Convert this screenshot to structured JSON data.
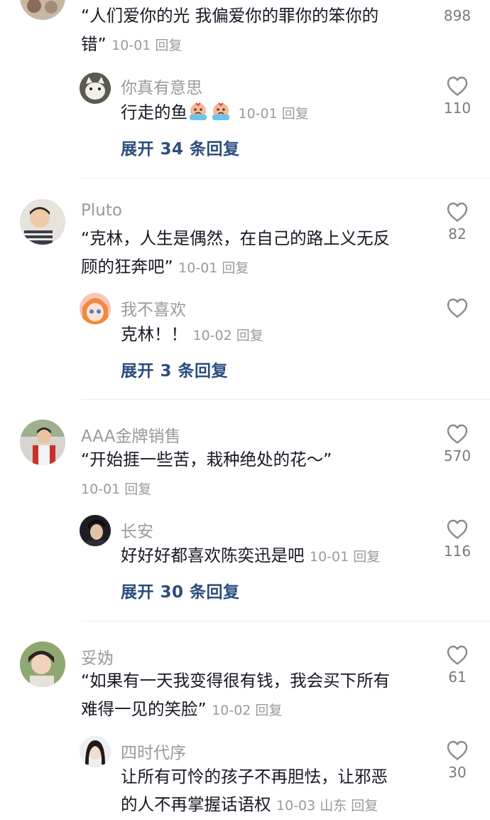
{
  "colors": {
    "primary_text": "#161823",
    "secondary_text": "#9a9a9a",
    "link": "#2a4d7e",
    "divider": "#ececec"
  },
  "comments": [
    {
      "line1": "“人们爱你的光 我偏爱你的罪你的笨你的",
      "line2": "错”",
      "date": "10-01",
      "reply_label": "回复",
      "likes": "898",
      "reply": {
        "username": "你真有意思",
        "text": "行走的鱼",
        "emoji_icon": "crying-face-emoji",
        "date": "10-01",
        "reply_label": "回复",
        "likes": "110"
      },
      "expand": "展开 34 条回复"
    },
    {
      "username": "Pluto",
      "line1": "“克林，人生是偶然，在自己的路上义无反",
      "line2": "顾的狂奔吧”",
      "date": "10-01",
      "reply_label": "回复",
      "likes": "82",
      "reply": {
        "username": "我不喜欢",
        "text": "克林！！",
        "date": "10-02",
        "reply_label": "回复"
      },
      "expand": "展开 3 条回复"
    },
    {
      "username": "AAA金牌销售",
      "line1": "“开始捱一些苦，栽种绝处的花～”",
      "date": "10-01",
      "reply_label": "回复",
      "likes": "570",
      "reply": {
        "username": "长安",
        "text": "好好好都喜欢陈奕迅是吧",
        "date": "10-01",
        "reply_label": "回复",
        "likes": "116"
      },
      "expand": "展开 30 条回复"
    },
    {
      "username": "妥妫",
      "line1": "“如果有一天我变得很有钱，我会买下所有",
      "line2": "难得一见的笑脸”",
      "date": "10-02",
      "reply_label": "回复",
      "likes": "61",
      "reply": {
        "username": "四时代序",
        "line1": "让所有可怜的孩子不再胆怯，让邪恶",
        "line2": "的人不再掌握话语权",
        "date": "10-03",
        "location": "山东",
        "reply_label": "回复",
        "likes": "30"
      }
    }
  ]
}
